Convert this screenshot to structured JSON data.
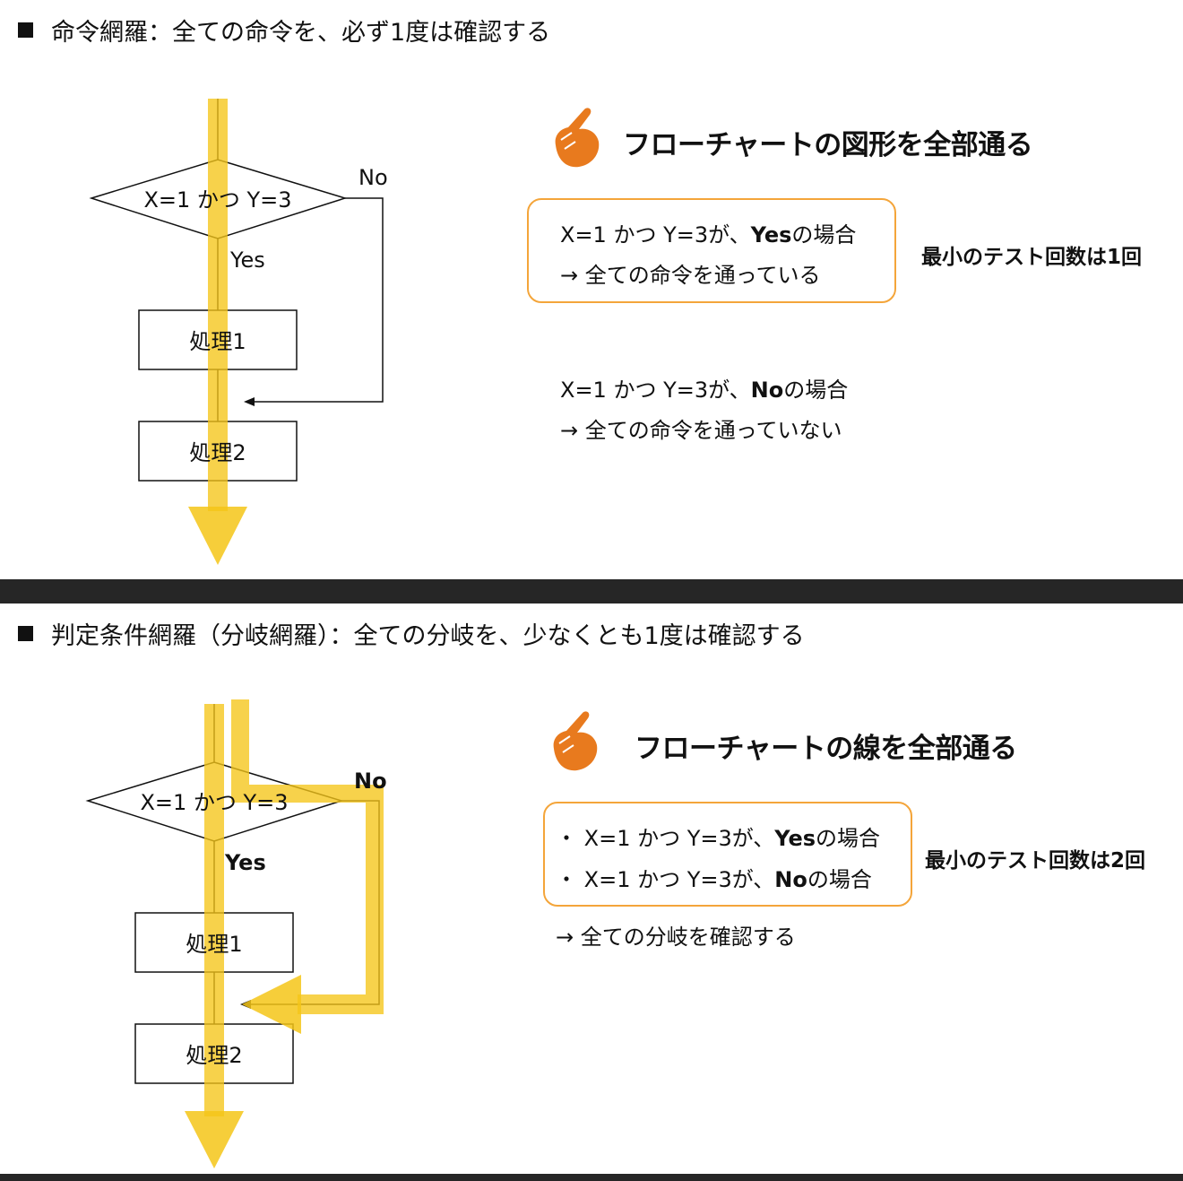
{
  "section1": {
    "heading": "命令網羅：全ての命令を、必ず1度は確認する",
    "flow": {
      "condition": "X=1 かつ Y=3",
      "no_label": "No",
      "yes_label": "Yes",
      "process1": "処理1",
      "process2": "処理2"
    },
    "title": "フローチャートの図形を全部通る",
    "yes_case": {
      "prefix": "X=1 かつ Y=3が、",
      "bold": "Yes",
      "suffix": "の場合",
      "result": "→  全ての命令を通っている"
    },
    "no_case": {
      "prefix": "X=1 かつ Y=3が、",
      "bold": "No",
      "suffix": "の場合",
      "result": "→  全ての命令を通っていない"
    },
    "min_tests": "最小のテスト回数は1回"
  },
  "section2": {
    "heading": "判定条件網羅（分岐網羅）：全ての分岐を、少なくとも1度は確認する",
    "flow": {
      "condition": "X=1 かつ Y=3",
      "no_label": "No",
      "yes_label": "Yes",
      "process1": "処理1",
      "process2": "処理2"
    },
    "title": "フローチャートの線を全部通る",
    "cases": [
      {
        "bullet": "・",
        "prefix": "X=1 かつ Y=3が、",
        "bold": "Yes",
        "suffix": "の場合"
      },
      {
        "bullet": "・",
        "prefix": "X=1 かつ Y=3が、",
        "bold": "No",
        "suffix": "の場合"
      }
    ],
    "result": "→  全ての分岐を確認する",
    "min_tests": "最小のテスト回数は2回"
  },
  "colors": {
    "highlight": "#f5c518",
    "callout_border": "#f4a53a",
    "hand": "#e87a1e",
    "divider": "#262626"
  },
  "icons": [
    "pointing-hand-icon",
    "square-bullet-icon",
    "arrow-down-icon"
  ]
}
